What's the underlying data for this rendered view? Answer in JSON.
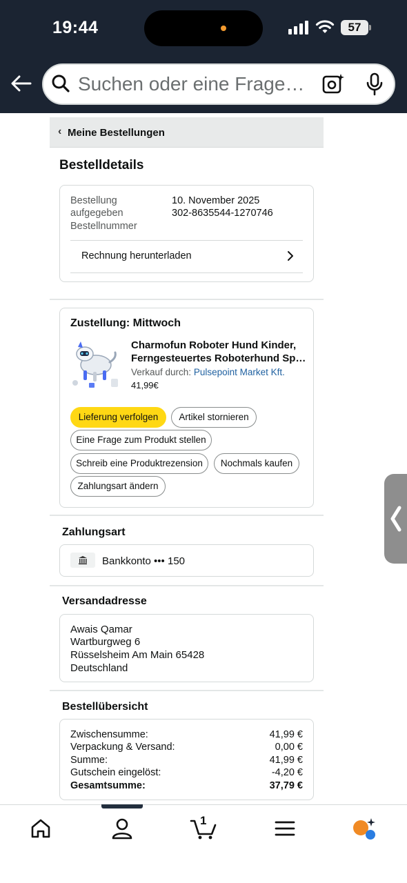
{
  "status_bar": {
    "time": "19:44",
    "battery": "57"
  },
  "search": {
    "placeholder": "Suchen oder eine Frage…"
  },
  "breadcrumb": {
    "label": "Meine Bestellungen"
  },
  "order_details": {
    "title": "Bestelldetails",
    "placed_label": "Bestellung aufgegeben",
    "placed_label_line1": "Bestellung",
    "placed_label_line2": "aufgegeben",
    "placed_value": "10. November 2025",
    "number_label": "Bestellnummer",
    "number_value": "302-8635544-1270746",
    "invoice_label": "Rechnung herunterladen"
  },
  "delivery": {
    "title": "Zustellung: Mittwoch",
    "product_title_line1": "Charmofun Roboter Hund Kinder,",
    "product_title_line2": "Ferngesteuertes Roboterhund Sp…",
    "seller_prefix": "Verkauf durch:",
    "seller_name": "Pulsepoint Market Kft.",
    "price": "41,99€",
    "actions": {
      "track": "Lieferung verfolgen",
      "cancel": "Artikel stornieren",
      "question": "Eine Frage zum Produkt stellen",
      "review": "Schreib eine Produktrezension",
      "buy_again": "Nochmals kaufen",
      "change_payment": "Zahlungsart ändern"
    }
  },
  "payment": {
    "title": "Zahlungsart",
    "method": "Bankkonto ••• 150"
  },
  "shipping": {
    "title": "Versandadresse",
    "name": "Awais Qamar",
    "street": "Wartburgweg 6",
    "city": "Rüsselsheim Am Main 65428",
    "country": "Deutschland"
  },
  "summary": {
    "title": "Bestellübersicht",
    "rows": [
      {
        "label": "Zwischensumme:",
        "value": "41,99 €"
      },
      {
        "label": "Verpackung & Versand:",
        "value": "0,00 €"
      },
      {
        "label": "Summe:",
        "value": "41,99 €"
      },
      {
        "label": "Gutschein eingelöst:",
        "value": "-4,20 €"
      },
      {
        "label": "Gesamtsumme:",
        "value": "37,79 €"
      }
    ]
  },
  "bottom_nav": {
    "cart_count": "1"
  },
  "colors": {
    "header": "#1b2432",
    "primary_button": "#ffd814",
    "link": "#2162a1",
    "accent_orange": "#f08a24",
    "accent_blue": "#2a7de1"
  }
}
